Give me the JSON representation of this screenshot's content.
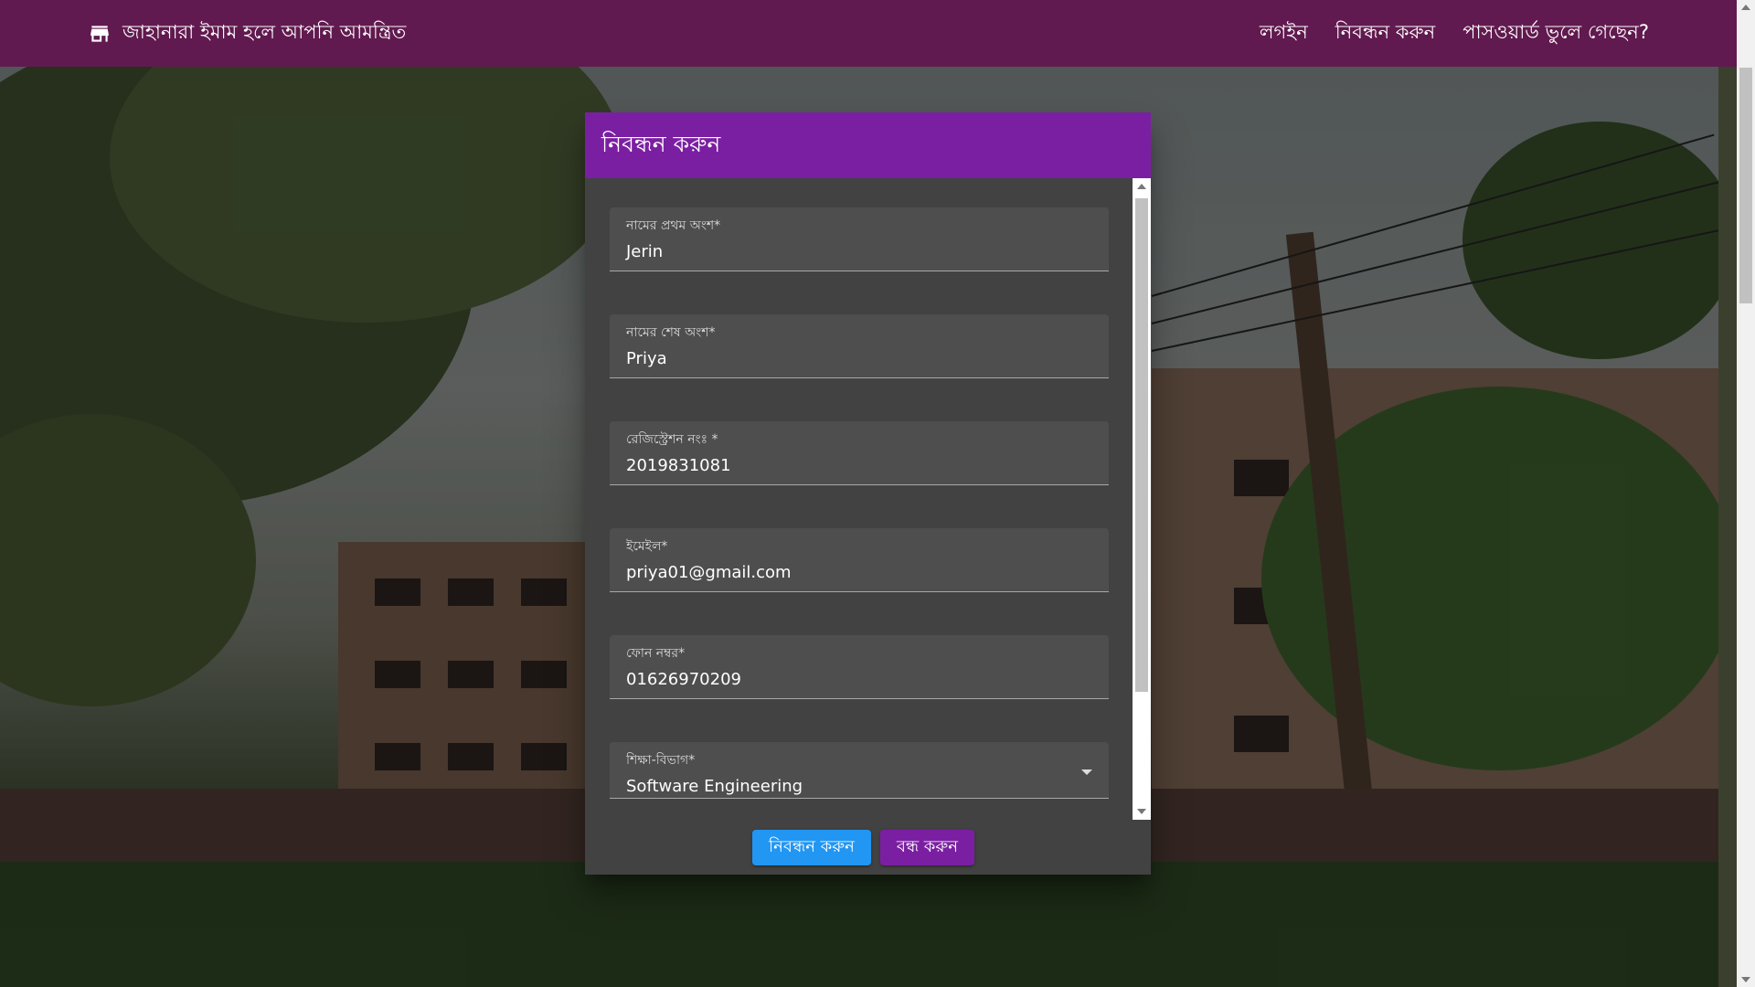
{
  "navbar": {
    "brand_icon": "store-icon",
    "brand_text": "জাহানারা ইমাম হলে আপনি আমন্ত্রিত",
    "links": [
      {
        "label": "লগইন"
      },
      {
        "label": "নিবন্ধন করুন"
      },
      {
        "label": "পাসওয়ার্ড ভুলে গেছেন?"
      }
    ],
    "bg_color": "#611a4f"
  },
  "dialog": {
    "title": "নিবন্ধন করুন",
    "header_color": "#7b1fa2",
    "fields": [
      {
        "label": "নামের প্রথম অংশ*",
        "value": "Jerin"
      },
      {
        "label": "নামের শেষ অংশ*",
        "value": "Priya"
      },
      {
        "label": "রেজিস্ট্রেশন নংঃ *",
        "value": "2019831081"
      },
      {
        "label": "ইমেইল*",
        "value": "priya01@gmail.com"
      },
      {
        "label": "ফোন নম্বর*",
        "value": "01626970209"
      },
      {
        "label": "শিক্ষা-বিভাগ*",
        "value": "Software Engineering"
      }
    ],
    "actions": {
      "submit_label": "নিবন্ধন করুন",
      "close_label": "বন্ধ করুন",
      "submit_color": "#2196f3",
      "close_color": "#7b1fa2"
    }
  }
}
